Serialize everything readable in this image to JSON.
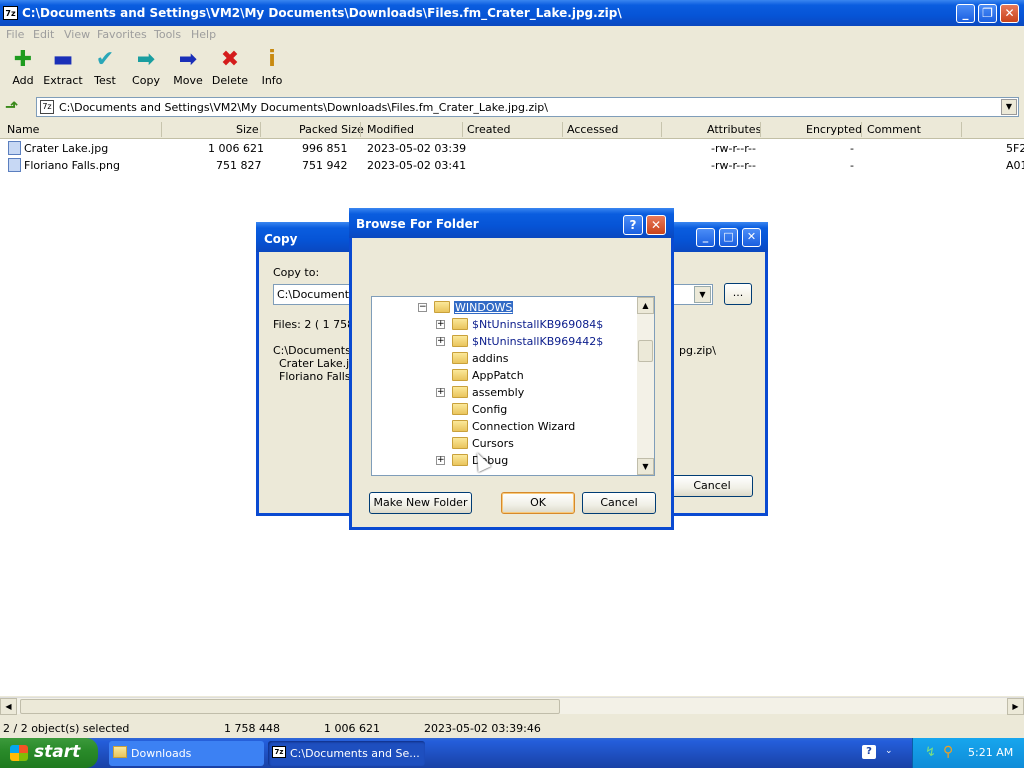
{
  "window": {
    "title": "C:\\Documents and Settings\\VM2\\My Documents\\Downloads\\Files.fm_Crater_Lake.jpg.zip\\",
    "icon_text": "7z"
  },
  "menu": [
    "File",
    "Edit",
    "View",
    "Favorites",
    "Tools",
    "Help"
  ],
  "toolbar": [
    {
      "label": "Add",
      "icon": "plus-icon",
      "glyph": "✚",
      "color": "#1e9b1e"
    },
    {
      "label": "Extract",
      "icon": "minus-icon",
      "glyph": "▬",
      "color": "#1a2fb8"
    },
    {
      "label": "Test",
      "icon": "check-icon",
      "glyph": "✔",
      "color": "#2aa7b8"
    },
    {
      "label": "Copy",
      "icon": "arrow-right-icon",
      "glyph": "➡",
      "color": "#1a9ea0"
    },
    {
      "label": "Move",
      "icon": "arrow-right-icon",
      "glyph": "➡",
      "color": "#1a2fb8"
    },
    {
      "label": "Delete",
      "icon": "x-icon",
      "glyph": "✖",
      "color": "#d41c1c"
    },
    {
      "label": "Info",
      "icon": "info-icon",
      "glyph": "i",
      "color": "#c88a10"
    }
  ],
  "address": {
    "path": "C:\\Documents and Settings\\VM2\\My Documents\\Downloads\\Files.fm_Crater_Lake.jpg.zip\\"
  },
  "columns": [
    "Name",
    "Size",
    "Packed Size",
    "Modified",
    "Created",
    "Accessed",
    "Attributes",
    "Encrypted",
    "Comment"
  ],
  "files": [
    {
      "name": "Crater Lake.jpg",
      "size": "1 006 621",
      "packed": "996 851",
      "modified": "2023-05-02 03:39",
      "attributes": "-rw-r--r--",
      "encrypted": "-",
      "crc": "5F2"
    },
    {
      "name": "Floriano Falls.png",
      "size": "751 827",
      "packed": "751 942",
      "modified": "2023-05-02 03:41",
      "attributes": "-rw-r--r--",
      "encrypted": "-",
      "crc": "A01"
    }
  ],
  "status": {
    "selected": "2 / 2 object(s) selected",
    "total_size": "1 758 448",
    "size": "1 006 621",
    "date": "2023-05-02 03:39:46"
  },
  "copy_dialog": {
    "title": "Copy",
    "copy_to_label": "Copy to:",
    "path_value": "C:\\Documents a",
    "files_info": "Files: 2    ( 1 758",
    "path_line": "C:\\Documents a",
    "path_tail": "pg.zip\\",
    "file1": "Crater Lake.jpg",
    "file2": "Floriano Falls.p",
    "browse_label": "...",
    "cancel_label": "Cancel"
  },
  "browse_dialog": {
    "title": "Browse For Folder",
    "help_label": "?",
    "close_label": "✕",
    "tree": [
      {
        "label": "WINDOWS",
        "level": 0,
        "expander": "−",
        "selected": true
      },
      {
        "label": "$NtUninstallKB969084$",
        "level": 1,
        "expander": "+",
        "blue": true
      },
      {
        "label": "$NtUninstallKB969442$",
        "level": 1,
        "expander": "+",
        "blue": true
      },
      {
        "label": "addins",
        "level": 1,
        "expander": ""
      },
      {
        "label": "AppPatch",
        "level": 1,
        "expander": ""
      },
      {
        "label": "assembly",
        "level": 1,
        "expander": "+"
      },
      {
        "label": "Config",
        "level": 1,
        "expander": ""
      },
      {
        "label": "Connection Wizard",
        "level": 1,
        "expander": ""
      },
      {
        "label": "Cursors",
        "level": 1,
        "expander": ""
      },
      {
        "label": "Debug",
        "level": 1,
        "expander": "+"
      }
    ],
    "make_new_folder": "Make New Folder",
    "ok": "OK",
    "cancel": "Cancel"
  },
  "taskbar": {
    "start": "start",
    "tasks": [
      {
        "label": "Downloads"
      },
      {
        "label": "C:\\Documents and Se..."
      }
    ],
    "clock": "5:21 AM"
  }
}
